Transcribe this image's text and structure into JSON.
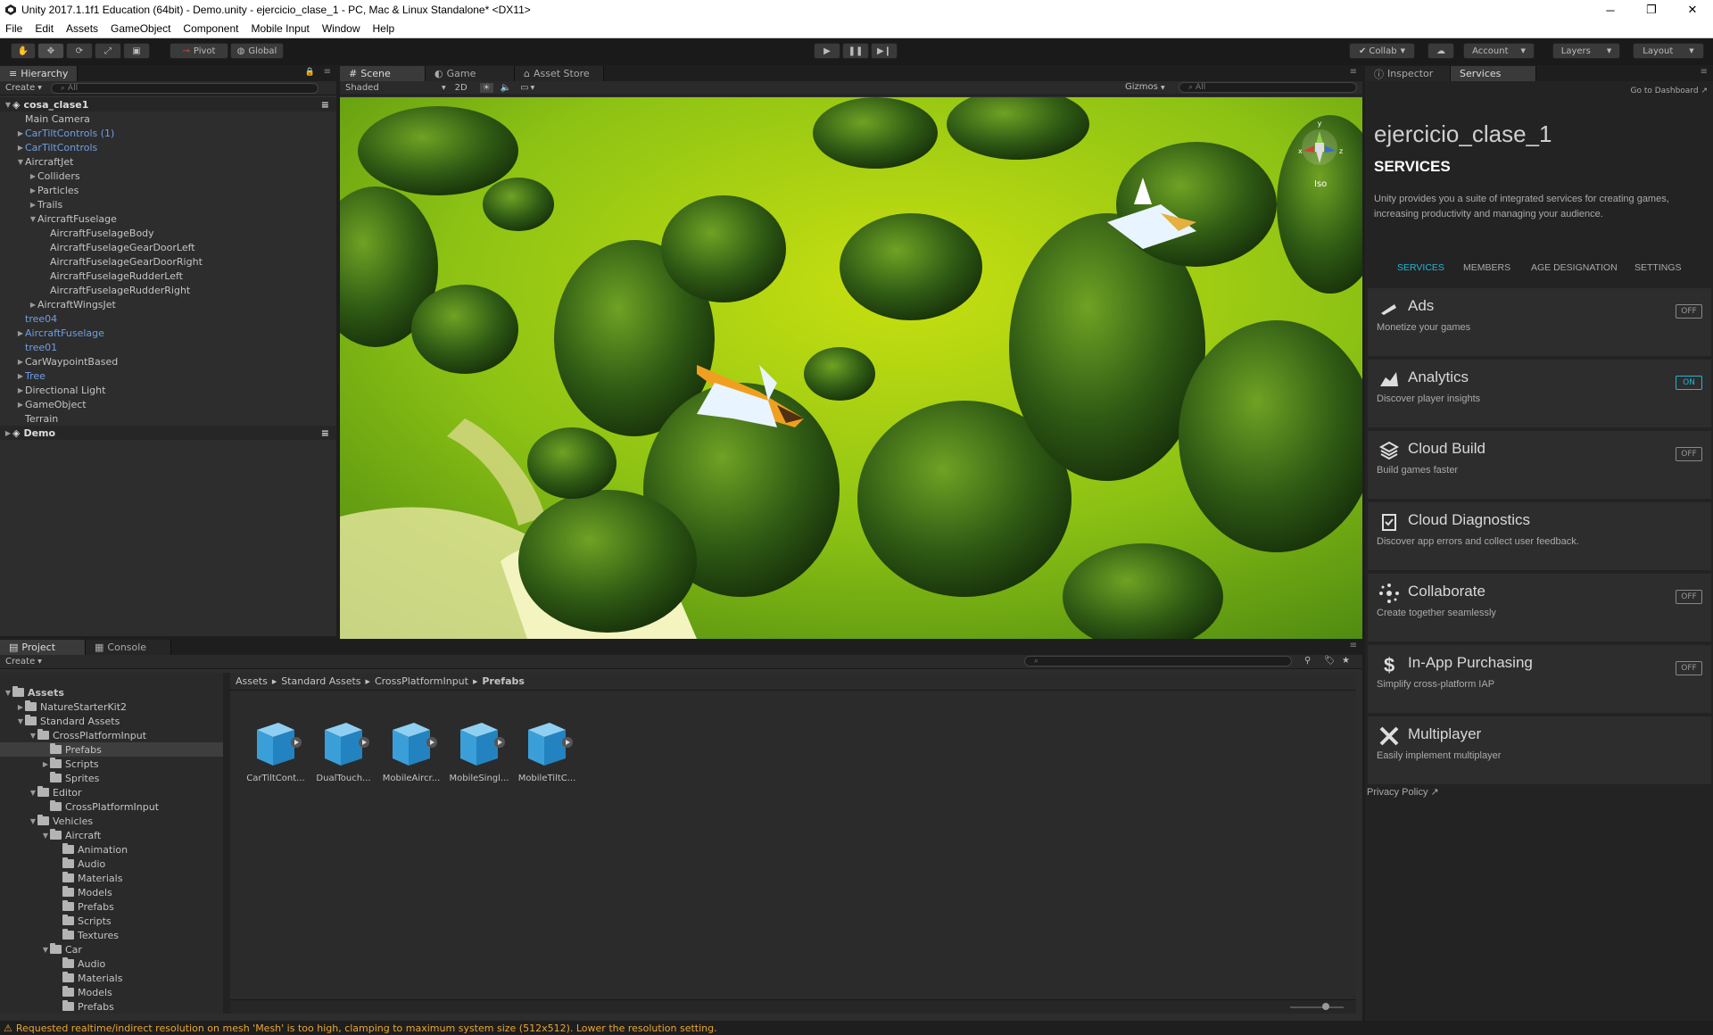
{
  "window": {
    "title": "Unity 2017.1.1f1 Education (64bit) - Demo.unity - ejercicio_clase_1 - PC, Mac & Linux Standalone* <DX11>"
  },
  "menu": [
    "File",
    "Edit",
    "Assets",
    "GameObject",
    "Component",
    "Mobile Input",
    "Window",
    "Help"
  ],
  "toolbar": {
    "pivot": "Pivot",
    "global": "Global",
    "collab": "Collab",
    "account": "Account",
    "layers": "Layers",
    "layout": "Layout"
  },
  "hierarchy": {
    "tab": "Hierarchy",
    "create": "Create",
    "search_placeholder": "All",
    "items": [
      {
        "label": "cosa_clase1",
        "kind": "scene",
        "tri": "▼"
      },
      {
        "label": "Main Camera",
        "kind": "normal",
        "tri": ""
      },
      {
        "label": "CarTiltControls (1)",
        "kind": "prefab",
        "tri": "▶"
      },
      {
        "label": "CarTiltControls",
        "kind": "prefab",
        "tri": "▶"
      },
      {
        "label": "AircraftJet",
        "kind": "normal",
        "tri": "▼"
      },
      {
        "label": "Colliders",
        "kind": "normal",
        "tri": "▶"
      },
      {
        "label": "Particles",
        "kind": "normal",
        "tri": "▶"
      },
      {
        "label": "Trails",
        "kind": "normal",
        "tri": "▶"
      },
      {
        "label": "AircraftFuselage",
        "kind": "normal",
        "tri": "▼"
      },
      {
        "label": "AircraftFuselageBody",
        "kind": "normal",
        "tri": ""
      },
      {
        "label": "AircraftFuselageGearDoorLeft",
        "kind": "normal",
        "tri": ""
      },
      {
        "label": "AircraftFuselageGearDoorRight",
        "kind": "normal",
        "tri": ""
      },
      {
        "label": "AircraftFuselageRudderLeft",
        "kind": "normal",
        "tri": ""
      },
      {
        "label": "AircraftFuselageRudderRight",
        "kind": "normal",
        "tri": ""
      },
      {
        "label": "AircraftWingsJet",
        "kind": "normal",
        "tri": "▶"
      },
      {
        "label": "tree04",
        "kind": "prefab",
        "tri": ""
      },
      {
        "label": "AircraftFuselage",
        "kind": "prefab",
        "tri": "▶"
      },
      {
        "label": "tree01",
        "kind": "prefab",
        "tri": ""
      },
      {
        "label": "CarWaypointBased",
        "kind": "normal",
        "tri": "▶"
      },
      {
        "label": "Tree",
        "kind": "prefab",
        "tri": "▶"
      },
      {
        "label": "Directional Light",
        "kind": "normal",
        "tri": "▶"
      },
      {
        "label": "GameObject",
        "kind": "normal",
        "tri": "▶"
      },
      {
        "label": "Terrain",
        "kind": "normal",
        "tri": ""
      },
      {
        "label": "Demo",
        "kind": "scene",
        "tri": "▶"
      }
    ]
  },
  "scene": {
    "tabs": [
      "Scene",
      "Game",
      "Asset Store"
    ],
    "shading": "Shaded",
    "mode2d": "2D",
    "gizmos": "Gizmos",
    "search_placeholder": "All",
    "iso": "Iso",
    "gizmo_axes": {
      "y": "y",
      "x": "x",
      "z": "z"
    }
  },
  "inspector": {
    "tabs": [
      "Inspector",
      "Services"
    ],
    "go_dashboard": "Go to Dashboard",
    "project_name": "ejercicio_clase_1",
    "heading": "SERVICES",
    "intro": "Unity provides you a suite of integrated services for creating games, increasing productivity and managing your audience.",
    "subtabs": [
      "SERVICES",
      "MEMBERS",
      "AGE DESIGNATION",
      "SETTINGS"
    ],
    "services": [
      {
        "name": "Ads",
        "desc": "Monetize your games",
        "state": "OFF",
        "icon": "ads-icon"
      },
      {
        "name": "Analytics",
        "desc": "Discover player insights",
        "state": "ON",
        "icon": "analytics-icon"
      },
      {
        "name": "Cloud Build",
        "desc": "Build games faster",
        "state": "OFF",
        "icon": "cloud-build-icon"
      },
      {
        "name": "Cloud Diagnostics",
        "desc": "Discover app errors and collect user feedback.",
        "state": "",
        "icon": "cloud-diagnostics-icon"
      },
      {
        "name": "Collaborate",
        "desc": "Create together seamlessly",
        "state": "OFF",
        "icon": "collaborate-icon"
      },
      {
        "name": "In-App Purchasing",
        "desc": "Simplify cross-platform IAP",
        "state": "OFF",
        "icon": "dollar-icon"
      },
      {
        "name": "Multiplayer",
        "desc": "Easily implement multiplayer",
        "state": "",
        "icon": "multiplayer-icon"
      }
    ],
    "privacy": "Privacy Policy"
  },
  "project": {
    "tabs": [
      "Project",
      "Console"
    ],
    "create": "Create",
    "breadcrumb": [
      "Assets",
      "Standard Assets",
      "CrossPlatformInput",
      "Prefabs"
    ],
    "tree": [
      {
        "label": "Assets",
        "depth": 0,
        "tri": "▼",
        "bold": true
      },
      {
        "label": "NatureStarterKit2",
        "depth": 1,
        "tri": "▶"
      },
      {
        "label": "Standard Assets",
        "depth": 1,
        "tri": "▼"
      },
      {
        "label": "CrossPlatformInput",
        "depth": 2,
        "tri": "▼"
      },
      {
        "label": "Prefabs",
        "depth": 3,
        "tri": "",
        "selected": true
      },
      {
        "label": "Scripts",
        "depth": 3,
        "tri": "▶"
      },
      {
        "label": "Sprites",
        "depth": 3,
        "tri": ""
      },
      {
        "label": "Editor",
        "depth": 2,
        "tri": "▼"
      },
      {
        "label": "CrossPlatformInput",
        "depth": 3,
        "tri": ""
      },
      {
        "label": "Vehicles",
        "depth": 2,
        "tri": "▼"
      },
      {
        "label": "Aircraft",
        "depth": 3,
        "tri": "▼"
      },
      {
        "label": "Animation",
        "depth": 4,
        "tri": ""
      },
      {
        "label": "Audio",
        "depth": 4,
        "tri": ""
      },
      {
        "label": "Materials",
        "depth": 4,
        "tri": ""
      },
      {
        "label": "Models",
        "depth": 4,
        "tri": ""
      },
      {
        "label": "Prefabs",
        "depth": 4,
        "tri": ""
      },
      {
        "label": "Scripts",
        "depth": 4,
        "tri": ""
      },
      {
        "label": "Textures",
        "depth": 4,
        "tri": ""
      },
      {
        "label": "Car",
        "depth": 3,
        "tri": "▼"
      },
      {
        "label": "Audio",
        "depth": 4,
        "tri": ""
      },
      {
        "label": "Materials",
        "depth": 4,
        "tri": ""
      },
      {
        "label": "Models",
        "depth": 4,
        "tri": ""
      },
      {
        "label": "Prefabs",
        "depth": 4,
        "tri": ""
      }
    ],
    "assets": [
      "CarTiltCont...",
      "DualTouch...",
      "MobileAircr...",
      "MobileSingl...",
      "MobileTiltC..."
    ]
  },
  "status": {
    "message": "Requested realtime/indirect resolution on mesh 'Mesh' is too high, clamping to maximum system size (512x512). Lower the resolution setting."
  }
}
